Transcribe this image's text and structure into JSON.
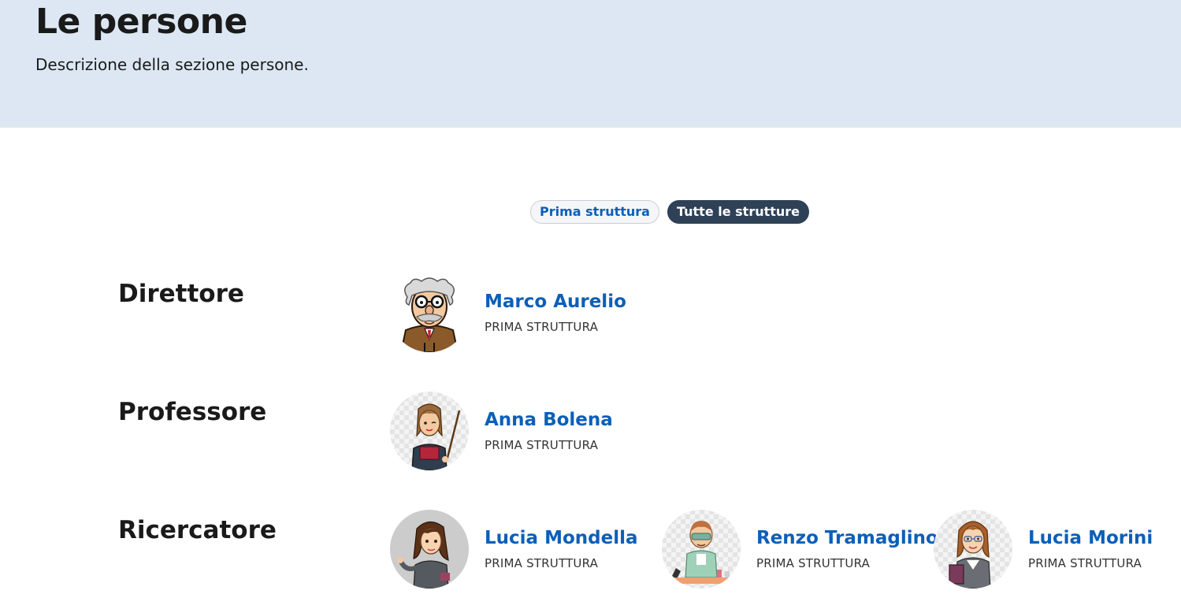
{
  "hero": {
    "title": "Le persone",
    "description": "Descrizione della sezione persone."
  },
  "filters": [
    "Prima struttura",
    "Tutte le strutture"
  ],
  "selected_filter": "Tutte le strutture",
  "groups": [
    {
      "role": "Direttore",
      "people": [
        {
          "name": "Marco Aurelio",
          "org": "PRIMA STRUTTURA",
          "avatar": "professor-cartoon-icon"
        }
      ]
    },
    {
      "role": "Professore",
      "people": [
        {
          "name": "Anna Bolena",
          "org": "PRIMA STRUTTURA",
          "avatar": "teacher-cartoon-icon"
        }
      ]
    },
    {
      "role": "Ricercatore",
      "people": [
        {
          "name": "Lucia Mondella",
          "org": "PRIMA STRUTTURA",
          "avatar": "woman-cartoon-icon"
        },
        {
          "name": "Renzo Tramaglino",
          "org": "PRIMA STRUTTURA",
          "avatar": "scientist-cartoon-icon"
        },
        {
          "name": "Lucia Morini",
          "org": "PRIMA STRUTTURA",
          "avatar": "woman-with-glasses-cartoon-icon"
        }
      ]
    }
  ],
  "colors": {
    "hero_bg": "#dce7f3",
    "link": "#0b5fb8",
    "active_pill": "#2e4157"
  }
}
